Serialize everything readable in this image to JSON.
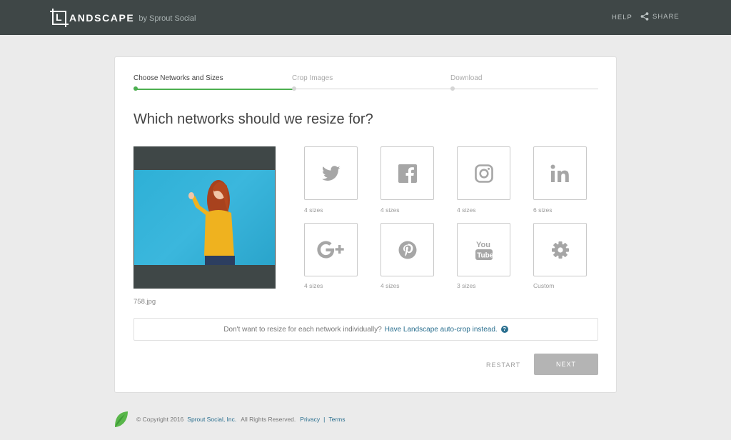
{
  "header": {
    "logo_word": "ANDSCAPE",
    "logo_mark_letter": "L",
    "logo_by": "by Sprout Social",
    "help_label": "HELP",
    "share_label": "SHARE",
    "bg_color": "#3f4747"
  },
  "steps": [
    {
      "label": "Choose Networks and Sizes",
      "active": true
    },
    {
      "label": "Crop Images",
      "active": false
    },
    {
      "label": "Download",
      "active": false
    }
  ],
  "heading": "Which networks should we resize for?",
  "image": {
    "filename": "758.jpg"
  },
  "networks": [
    {
      "name": "twitter",
      "icon": "twitter-icon",
      "caption": "4 sizes"
    },
    {
      "name": "facebook",
      "icon": "facebook-icon",
      "caption": "4 sizes"
    },
    {
      "name": "instagram",
      "icon": "instagram-icon",
      "caption": "4 sizes"
    },
    {
      "name": "linkedin",
      "icon": "linkedin-icon",
      "caption": "6 sizes"
    },
    {
      "name": "google-plus",
      "icon": "google-plus-icon",
      "caption": "4 sizes"
    },
    {
      "name": "pinterest",
      "icon": "pinterest-icon",
      "caption": "4 sizes"
    },
    {
      "name": "youtube",
      "icon": "youtube-icon",
      "caption": "3 sizes"
    },
    {
      "name": "custom",
      "icon": "gear-icon",
      "caption": "Custom"
    }
  ],
  "autocrop": {
    "prompt": "Don't want to resize for each network individually?",
    "link": "Have Landscape auto-crop instead.",
    "help_glyph": "?"
  },
  "actions": {
    "restart": "RESTART",
    "next": "NEXT"
  },
  "footer": {
    "copyright": "© Copyright 2016",
    "company": "Sprout Social, Inc.",
    "rights": "All Rights Reserved.",
    "privacy": "Privacy",
    "separator": "|",
    "terms": "Terms"
  },
  "colors": {
    "accent": "#4caf50",
    "link": "#2a6f8f",
    "icon": "#a6a6a6",
    "next_button": "#b4b4b4"
  }
}
